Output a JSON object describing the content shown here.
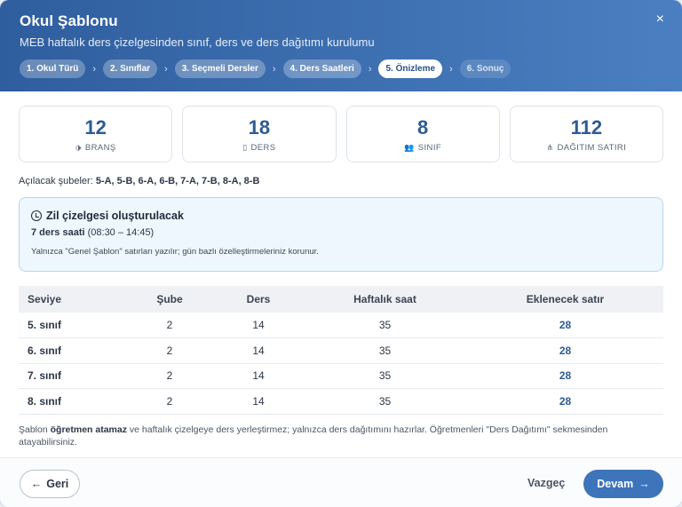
{
  "header": {
    "title": "Okul Şablonu",
    "subtitle": "MEB haftalık ders çizelgesinden sınıf, ders ve ders dağıtımı kurulumu",
    "close": "×"
  },
  "steps": [
    {
      "label": "1. Okul Türü"
    },
    {
      "label": "2. Sınıflar"
    },
    {
      "label": "3. Seçmeli Dersler"
    },
    {
      "label": "4. Ders Saatleri"
    },
    {
      "label": "5. Önizleme"
    },
    {
      "label": "6. Sonuç"
    }
  ],
  "stats": [
    {
      "value": "12",
      "label": "BRANŞ",
      "icon": "tag-icon",
      "glyph": "⬗"
    },
    {
      "value": "18",
      "label": "DERS",
      "icon": "book-icon",
      "glyph": "▯"
    },
    {
      "value": "8",
      "label": "SINIF",
      "icon": "users-icon",
      "glyph": "👥"
    },
    {
      "value": "112",
      "label": "DAĞITIM SATIRI",
      "icon": "network-icon",
      "glyph": "⋔"
    }
  ],
  "branches": {
    "label": "Açılacak şubeler:",
    "value": "5-A, 5-B, 6-A, 6-B, 7-A, 7-B, 8-A, 8-B"
  },
  "info": {
    "title": "Zil çizelgesi oluşturulacak",
    "hours_bold": "7 ders saati",
    "hours_range": "(08:30 – 14:45)",
    "note": "Yalnızca \"Genel Şablon\" satırları yazılır; gün bazlı özelleştirmeleriniz korunur."
  },
  "table": {
    "headers": [
      "Seviye",
      "Şube",
      "Ders",
      "Haftalık saat",
      "Eklenecek satır"
    ],
    "rows": [
      [
        "5. sınıf",
        "2",
        "14",
        "35",
        "28"
      ],
      [
        "6. sınıf",
        "2",
        "14",
        "35",
        "28"
      ],
      [
        "7. sınıf",
        "2",
        "14",
        "35",
        "28"
      ],
      [
        "8. sınıf",
        "2",
        "14",
        "35",
        "28"
      ]
    ]
  },
  "footnote": {
    "pre": "Şablon ",
    "bold": "öğretmen atamaz",
    "post": " ve haftalık çizelgeye ders yerleştirmez; yalnızca ders dağıtımını hazırlar. Öğretmenleri \"Ders Dağıtımı\" sekmesinden atayabilirsiniz."
  },
  "footer": {
    "back": "Geri",
    "cancel": "Vazgeç",
    "next": "Devam"
  }
}
